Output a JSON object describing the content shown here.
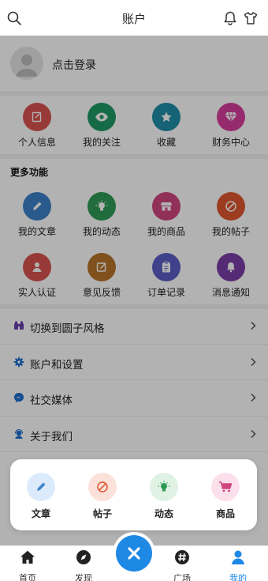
{
  "header": {
    "title": "账户"
  },
  "login": {
    "text": "点击登录"
  },
  "quick": [
    {
      "label": "个人信息",
      "color": "#d9544f",
      "icon": "edit-icon"
    },
    {
      "label": "我的关注",
      "color": "#1f9a64",
      "icon": "eye-icon"
    },
    {
      "label": "收藏",
      "color": "#1f8ea7",
      "icon": "star-icon"
    },
    {
      "label": "财务中心",
      "color": "#d63e9c",
      "icon": "diamond-icon"
    }
  ],
  "more": {
    "title": "更多功能"
  },
  "features_row1": [
    {
      "label": "我的文章",
      "color": "#3b82c8",
      "icon": "pencil-icon"
    },
    {
      "label": "我的动态",
      "color": "#2e9b57",
      "icon": "bulb-icon"
    },
    {
      "label": "我的商品",
      "color": "#d0457f",
      "icon": "store-icon"
    },
    {
      "label": "我的帖子",
      "color": "#e0562f",
      "icon": "post-icon"
    }
  ],
  "features_row2": [
    {
      "label": "实人认证",
      "color": "#d9544f",
      "icon": "user-verify-icon"
    },
    {
      "label": "意见反馈",
      "color": "#b8732a",
      "icon": "feedback-icon"
    },
    {
      "label": "订单记录",
      "color": "#5b5fc7",
      "icon": "clipboard-icon"
    },
    {
      "label": "消息通知",
      "color": "#7b3ea8",
      "icon": "bell-icon"
    }
  ],
  "list": [
    {
      "label": "切换到圆子风格",
      "icon": "binoculars-icon",
      "color": "#6a3fb0"
    },
    {
      "label": "账户和设置",
      "icon": "gear-icon",
      "color": "#1e6fd0"
    },
    {
      "label": "社交媒体",
      "icon": "messenger-icon",
      "color": "#1e6fd0"
    },
    {
      "label": "关于我们",
      "icon": "support-icon",
      "color": "#1e6fd0"
    }
  ],
  "popup": [
    {
      "label": "文章",
      "bg": "#dcebfb",
      "fg": "#3b82c8",
      "icon": "pencil-icon"
    },
    {
      "label": "帖子",
      "bg": "#fbe1da",
      "fg": "#e0562f",
      "icon": "post-icon"
    },
    {
      "label": "动态",
      "bg": "#dff2e4",
      "fg": "#2e9b57",
      "icon": "bulb-icon"
    },
    {
      "label": "商品",
      "bg": "#fbe0ec",
      "fg": "#d0457f",
      "icon": "cart-icon"
    }
  ],
  "tabbar": [
    {
      "label": "首页",
      "icon": "home-icon"
    },
    {
      "label": "发现",
      "icon": "compass-icon"
    },
    {
      "label": "广场",
      "icon": "hashtag-icon"
    },
    {
      "label": "我的",
      "icon": "person-icon",
      "active": true
    }
  ],
  "fab": {
    "icon": "close-icon",
    "color": "#1e88e5"
  }
}
